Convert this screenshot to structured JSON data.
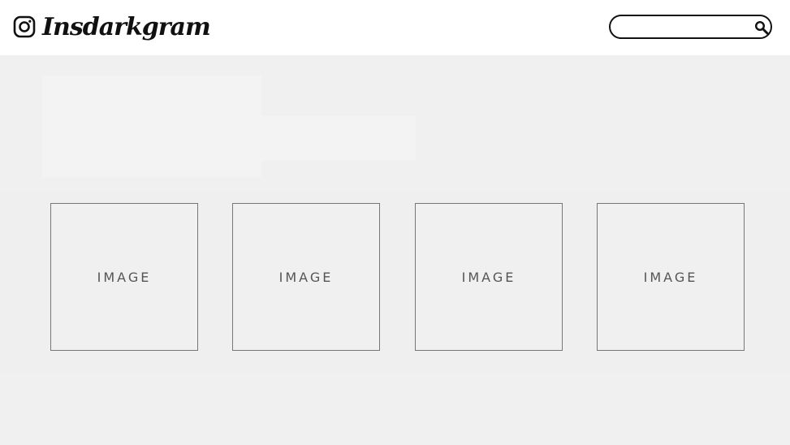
{
  "app": {
    "brand": "Insdarkgram",
    "logo_icon": "instagram-camera-icon"
  },
  "search": {
    "value": "",
    "placeholder": "",
    "icon": "search-icon"
  },
  "gallery": {
    "items": [
      {
        "label": "IMAGE"
      },
      {
        "label": "IMAGE"
      },
      {
        "label": "IMAGE"
      },
      {
        "label": "IMAGE"
      }
    ]
  },
  "colors": {
    "background": "#f0f0f0",
    "header": "#ffffff",
    "text": "#111111",
    "card_border": "#777777"
  }
}
